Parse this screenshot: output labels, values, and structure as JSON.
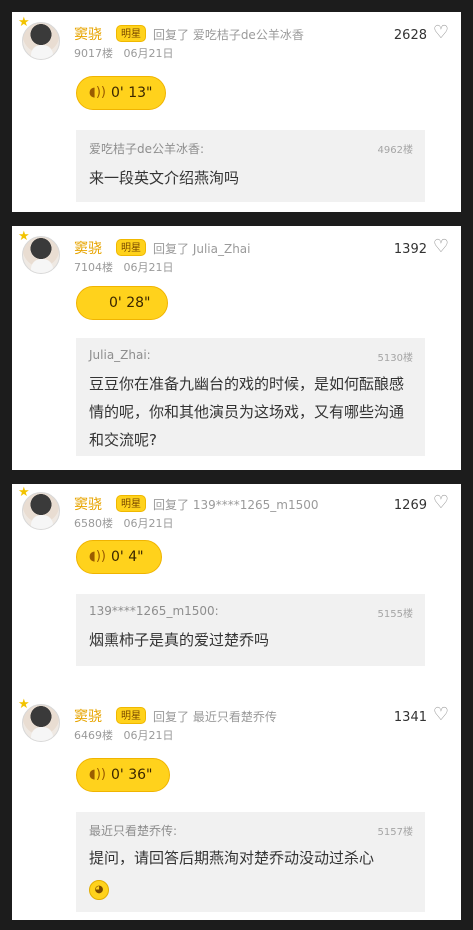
{
  "posts": [
    {
      "author": "窦骁",
      "badge": "明星",
      "reply_to": "回复了 爱吃桔子de公羊冰香",
      "floor": "9017楼",
      "date": "06月21日",
      "likes": "2628",
      "voice_duration": "0' 13\"",
      "quote_user": "爱吃桔子de公羊冰香:",
      "quote_floor": "4962楼",
      "quote_text": "来一段英文介绍燕洵吗"
    },
    {
      "author": "窦骁",
      "badge": "明星",
      "reply_to": "回复了 Julia_Zhai",
      "floor": "7104楼",
      "date": "06月21日",
      "likes": "1392",
      "voice_duration": "0' 28\"",
      "quote_user": "Julia_Zhai:",
      "quote_floor": "5130楼",
      "quote_text": "豆豆你在准备九幽台的戏的时候，是如何酝酿感情的呢，你和其他演员为这场戏，又有哪些沟通和交流呢?"
    },
    {
      "author": "窦骁",
      "badge": "明星",
      "reply_to": "回复了 139****1265_m1500",
      "floor": "6580楼",
      "date": "06月21日",
      "likes": "1269",
      "voice_duration": "0' 4\"",
      "quote_user": "139****1265_m1500:",
      "quote_floor": "5155楼",
      "quote_text": "烟熏柿子是真的爱过楚乔吗"
    },
    {
      "author": "窦骁",
      "badge": "明星",
      "reply_to": "回复了 最近只看楚乔传",
      "floor": "6469楼",
      "date": "06月21日",
      "likes": "1341",
      "voice_duration": "0' 36\"",
      "quote_user": "最近只看楚乔传:",
      "quote_floor": "5157楼",
      "quote_text": "提问，请回答后期燕洵对楚乔动没动过杀心"
    }
  ],
  "icons": {
    "heart": "heart-outline-icon",
    "crown": "crown-icon",
    "voice": "sound-wave-icon",
    "emoji": "emoji-icon"
  },
  "colors": {
    "accent": "#ffd21c",
    "name": "#e7a400",
    "frame": "#1c1c1c",
    "quote_bg": "#f1f1f1"
  }
}
